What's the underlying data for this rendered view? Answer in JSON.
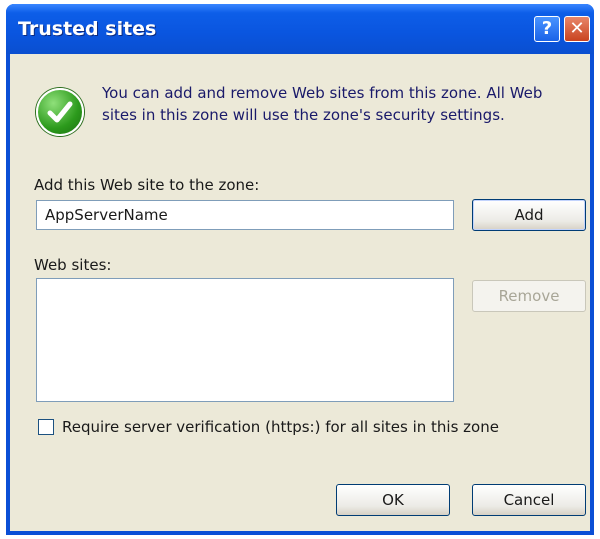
{
  "window": {
    "title": "Trusted sites"
  },
  "titlebar": {
    "help_glyph": "?",
    "close_glyph": "✕"
  },
  "info": {
    "icon": "green-checkmark-icon",
    "text": "You can add and remove Web sites from this zone. All Web sites in this zone will use the zone's security settings."
  },
  "add_site": {
    "label": "Add this Web site to the zone:",
    "value": "AppServerName",
    "add_button": "Add"
  },
  "web_sites": {
    "label": "Web sites:",
    "items": [],
    "remove_button": "Remove"
  },
  "require_verification": {
    "label": "Require server verification (https:) for all sites in this zone",
    "checked": false
  },
  "footer": {
    "ok_button": "OK",
    "cancel_button": "Cancel"
  },
  "colors": {
    "titlebar_blue": "#0a55df",
    "dialog_background": "#ece9d8",
    "close_red": "#c9431f",
    "check_green": "#2c9a1c"
  }
}
